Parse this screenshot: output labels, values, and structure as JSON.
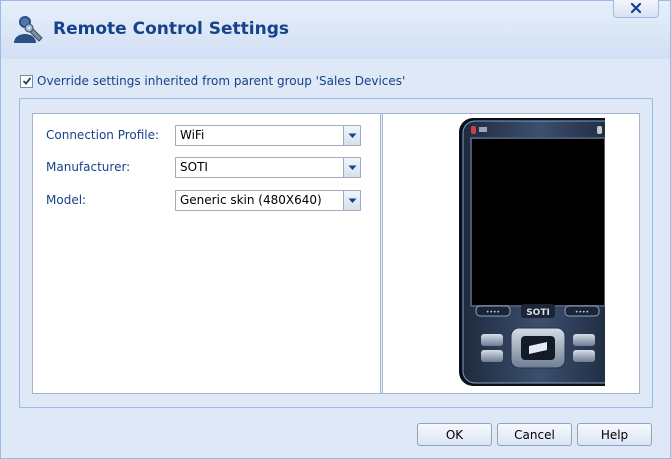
{
  "window": {
    "title": "Remote Control Settings",
    "close_glyph": "×"
  },
  "override": {
    "checked": true,
    "label": "Override settings inherited from parent group 'Sales Devices'"
  },
  "form": {
    "connection_profile": {
      "label": "Connection Profile:",
      "value": "WiFi"
    },
    "manufacturer": {
      "label": "Manufacturer:",
      "value": "SOTI"
    },
    "model": {
      "label": "Model:",
      "value": "Generic skin (480X640)"
    }
  },
  "device_preview": {
    "brand": "SOTI"
  },
  "buttons": {
    "ok": "OK",
    "cancel": "Cancel",
    "help": "Help"
  },
  "colors": {
    "accent": "#15428b",
    "background": "#dfe8f6",
    "border": "#99bbe8"
  }
}
